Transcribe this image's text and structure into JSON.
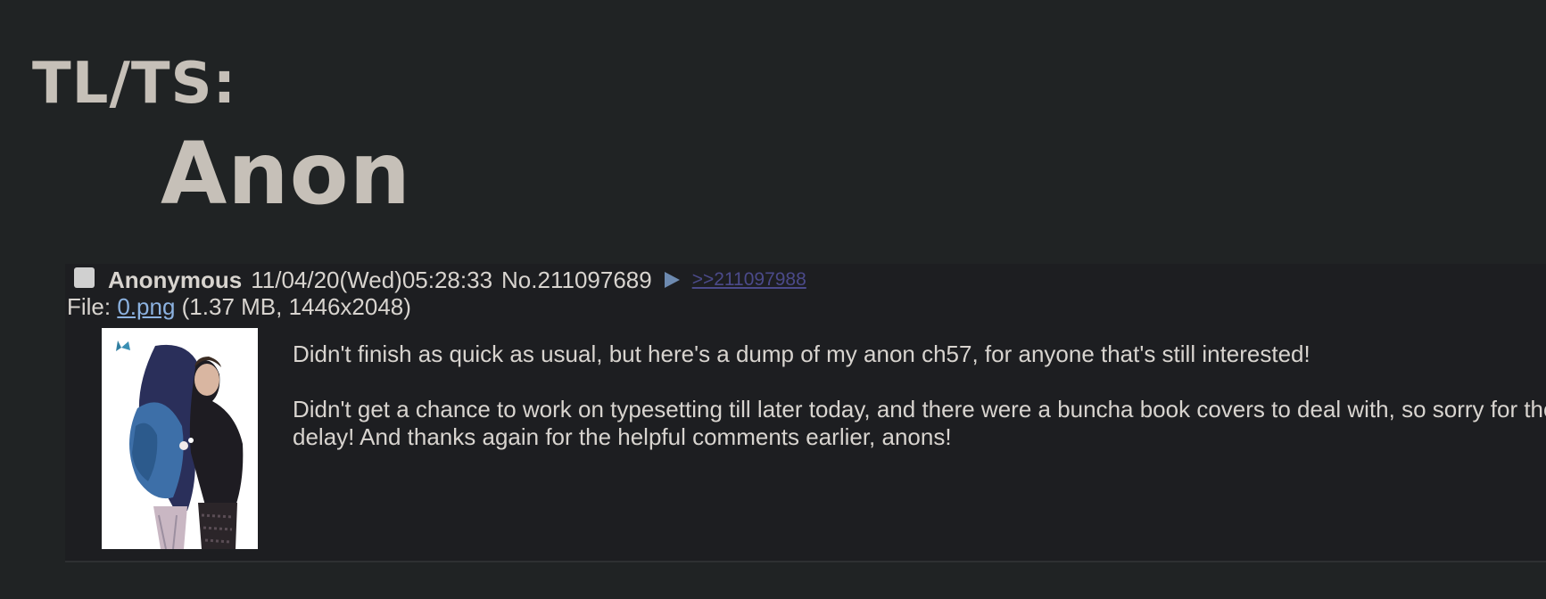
{
  "header": {
    "line1": "TL/TS:",
    "line2": "Anon"
  },
  "post": {
    "name": "Anonymous",
    "datetime": "11/04/20(Wed)05:28:33",
    "number": "No.211097689",
    "backlink": ">>211097988",
    "file": {
      "prefix": "File: ",
      "filename": "0.png",
      "details": " (1.37 MB, 1446x2048)"
    },
    "message": {
      "para1": "Didn't finish as quick as usual, but here's a dump of my anon ch57, for anyone that's still interested!",
      "para2_line1": "Didn't get a chance to work on typesetting till later today, and there were a buncha book covers to deal with, so sorry for the",
      "para2_line2": "delay! And thanks again for the helpful comments earlier, anons!"
    }
  },
  "colors": {
    "background": "#202324",
    "post_background": "#1d1e21",
    "text": "#d8d4cf",
    "link": "#8cb2e0",
    "backlink": "#4b4a8a",
    "header_text": "#c6c0b8"
  },
  "icons": {
    "post_menu": "play-triangle-icon",
    "select": "checkbox"
  }
}
